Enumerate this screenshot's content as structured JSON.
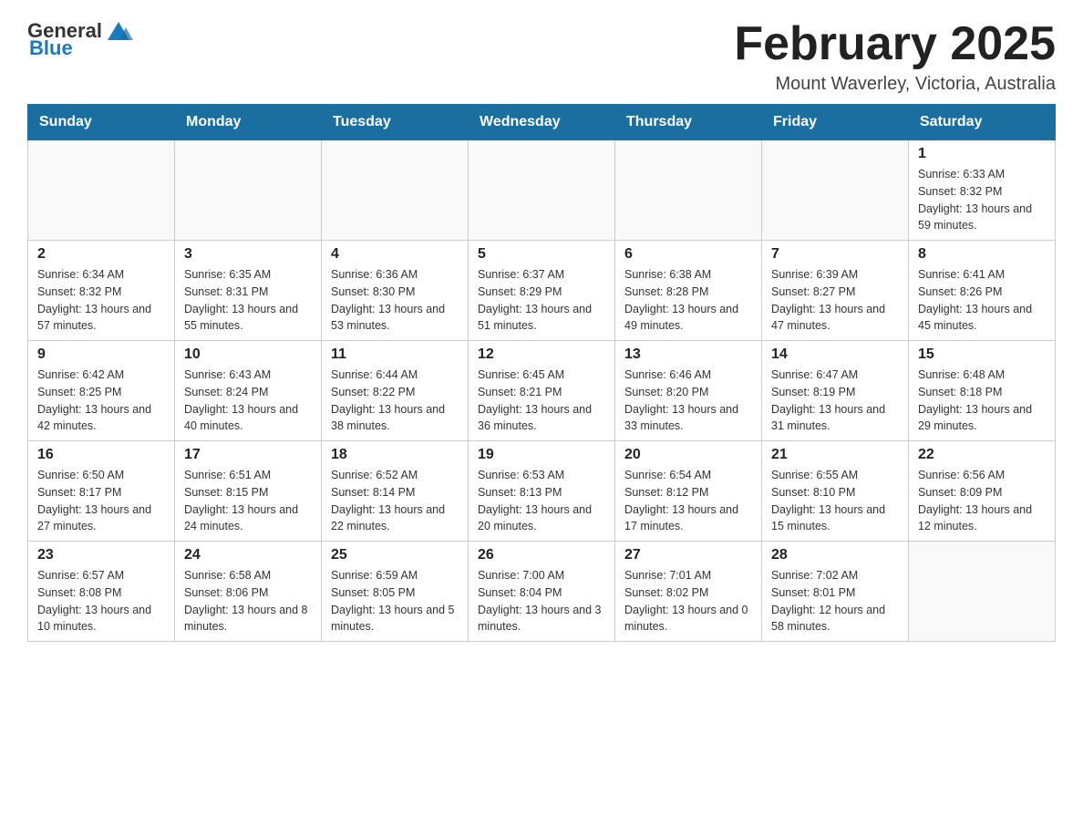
{
  "header": {
    "logo_text_general": "General",
    "logo_text_blue": "Blue",
    "month_title": "February 2025",
    "location": "Mount Waverley, Victoria, Australia"
  },
  "days_of_week": [
    "Sunday",
    "Monday",
    "Tuesday",
    "Wednesday",
    "Thursday",
    "Friday",
    "Saturday"
  ],
  "weeks": [
    [
      {
        "day": "",
        "info": ""
      },
      {
        "day": "",
        "info": ""
      },
      {
        "day": "",
        "info": ""
      },
      {
        "day": "",
        "info": ""
      },
      {
        "day": "",
        "info": ""
      },
      {
        "day": "",
        "info": ""
      },
      {
        "day": "1",
        "info": "Sunrise: 6:33 AM\nSunset: 8:32 PM\nDaylight: 13 hours and 59 minutes."
      }
    ],
    [
      {
        "day": "2",
        "info": "Sunrise: 6:34 AM\nSunset: 8:32 PM\nDaylight: 13 hours and 57 minutes."
      },
      {
        "day": "3",
        "info": "Sunrise: 6:35 AM\nSunset: 8:31 PM\nDaylight: 13 hours and 55 minutes."
      },
      {
        "day": "4",
        "info": "Sunrise: 6:36 AM\nSunset: 8:30 PM\nDaylight: 13 hours and 53 minutes."
      },
      {
        "day": "5",
        "info": "Sunrise: 6:37 AM\nSunset: 8:29 PM\nDaylight: 13 hours and 51 minutes."
      },
      {
        "day": "6",
        "info": "Sunrise: 6:38 AM\nSunset: 8:28 PM\nDaylight: 13 hours and 49 minutes."
      },
      {
        "day": "7",
        "info": "Sunrise: 6:39 AM\nSunset: 8:27 PM\nDaylight: 13 hours and 47 minutes."
      },
      {
        "day": "8",
        "info": "Sunrise: 6:41 AM\nSunset: 8:26 PM\nDaylight: 13 hours and 45 minutes."
      }
    ],
    [
      {
        "day": "9",
        "info": "Sunrise: 6:42 AM\nSunset: 8:25 PM\nDaylight: 13 hours and 42 minutes."
      },
      {
        "day": "10",
        "info": "Sunrise: 6:43 AM\nSunset: 8:24 PM\nDaylight: 13 hours and 40 minutes."
      },
      {
        "day": "11",
        "info": "Sunrise: 6:44 AM\nSunset: 8:22 PM\nDaylight: 13 hours and 38 minutes."
      },
      {
        "day": "12",
        "info": "Sunrise: 6:45 AM\nSunset: 8:21 PM\nDaylight: 13 hours and 36 minutes."
      },
      {
        "day": "13",
        "info": "Sunrise: 6:46 AM\nSunset: 8:20 PM\nDaylight: 13 hours and 33 minutes."
      },
      {
        "day": "14",
        "info": "Sunrise: 6:47 AM\nSunset: 8:19 PM\nDaylight: 13 hours and 31 minutes."
      },
      {
        "day": "15",
        "info": "Sunrise: 6:48 AM\nSunset: 8:18 PM\nDaylight: 13 hours and 29 minutes."
      }
    ],
    [
      {
        "day": "16",
        "info": "Sunrise: 6:50 AM\nSunset: 8:17 PM\nDaylight: 13 hours and 27 minutes."
      },
      {
        "day": "17",
        "info": "Sunrise: 6:51 AM\nSunset: 8:15 PM\nDaylight: 13 hours and 24 minutes."
      },
      {
        "day": "18",
        "info": "Sunrise: 6:52 AM\nSunset: 8:14 PM\nDaylight: 13 hours and 22 minutes."
      },
      {
        "day": "19",
        "info": "Sunrise: 6:53 AM\nSunset: 8:13 PM\nDaylight: 13 hours and 20 minutes."
      },
      {
        "day": "20",
        "info": "Sunrise: 6:54 AM\nSunset: 8:12 PM\nDaylight: 13 hours and 17 minutes."
      },
      {
        "day": "21",
        "info": "Sunrise: 6:55 AM\nSunset: 8:10 PM\nDaylight: 13 hours and 15 minutes."
      },
      {
        "day": "22",
        "info": "Sunrise: 6:56 AM\nSunset: 8:09 PM\nDaylight: 13 hours and 12 minutes."
      }
    ],
    [
      {
        "day": "23",
        "info": "Sunrise: 6:57 AM\nSunset: 8:08 PM\nDaylight: 13 hours and 10 minutes."
      },
      {
        "day": "24",
        "info": "Sunrise: 6:58 AM\nSunset: 8:06 PM\nDaylight: 13 hours and 8 minutes."
      },
      {
        "day": "25",
        "info": "Sunrise: 6:59 AM\nSunset: 8:05 PM\nDaylight: 13 hours and 5 minutes."
      },
      {
        "day": "26",
        "info": "Sunrise: 7:00 AM\nSunset: 8:04 PM\nDaylight: 13 hours and 3 minutes."
      },
      {
        "day": "27",
        "info": "Sunrise: 7:01 AM\nSunset: 8:02 PM\nDaylight: 13 hours and 0 minutes."
      },
      {
        "day": "28",
        "info": "Sunrise: 7:02 AM\nSunset: 8:01 PM\nDaylight: 12 hours and 58 minutes."
      },
      {
        "day": "",
        "info": ""
      }
    ]
  ]
}
